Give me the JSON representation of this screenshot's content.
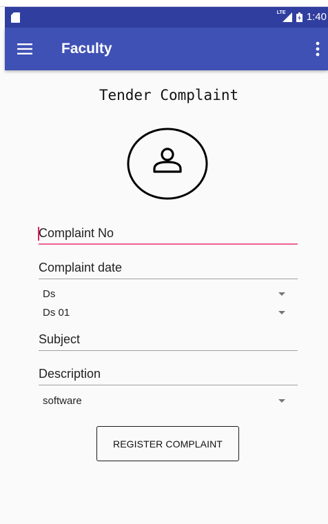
{
  "status_bar": {
    "network_label": "LTE",
    "time": "1:40",
    "icons": [
      "sd-card-icon",
      "signal-icon",
      "battery-icon"
    ]
  },
  "app_bar": {
    "title": "Faculty",
    "menu_icon": "menu-icon",
    "overflow_icon": "more-vert-icon"
  },
  "form": {
    "title": "Tender Complaint",
    "avatar_icon": "person-icon",
    "complaint_no_placeholder": "Complaint No",
    "complaint_date_placeholder": "Complaint date",
    "spinner_1_value": "Ds",
    "spinner_2_value": "Ds 01",
    "subject_placeholder": "Subject",
    "description_placeholder": "Description",
    "spinner_3_value": "software",
    "register_label": "REGISTER COMPLAINT"
  },
  "colors": {
    "status_bar": "#303f9f",
    "app_bar": "#3f51b5",
    "focus_accent": "#f06292",
    "background": "#fafafa"
  }
}
